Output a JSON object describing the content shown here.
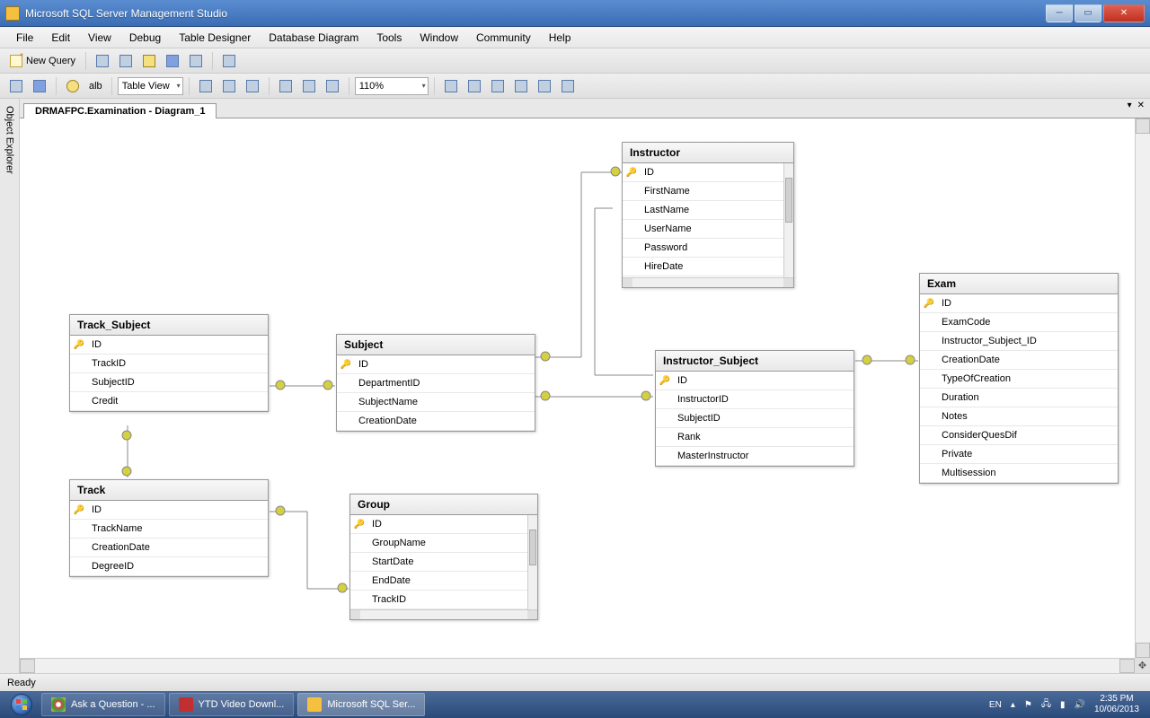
{
  "window": {
    "title": "Microsoft SQL Server Management Studio"
  },
  "menu": [
    "File",
    "Edit",
    "View",
    "Debug",
    "Table Designer",
    "Database Diagram",
    "Tools",
    "Window",
    "Community",
    "Help"
  ],
  "toolbar1": {
    "new_query": "New Query",
    "table_view": "Table View",
    "alb_label": "alb",
    "zoom": "110%"
  },
  "sidebar": {
    "object_explorer": "Object Explorer"
  },
  "tab": {
    "label": "DRMAFPC.Examination - Diagram_1"
  },
  "tables": {
    "track_subject": {
      "title": "Track_Subject",
      "cols": [
        "ID",
        "TrackID",
        "SubjectID",
        "Credit"
      ]
    },
    "subject": {
      "title": "Subject",
      "cols": [
        "ID",
        "DepartmentID",
        "SubjectName",
        "CreationDate"
      ]
    },
    "track": {
      "title": "Track",
      "cols": [
        "ID",
        "TrackName",
        "CreationDate",
        "DegreeID"
      ]
    },
    "group": {
      "title": "Group",
      "cols": [
        "ID",
        "GroupName",
        "StartDate",
        "EndDate",
        "TrackID"
      ]
    },
    "instructor": {
      "title": "Instructor",
      "cols": [
        "ID",
        "FirstName",
        "LastName",
        "UserName",
        "Password",
        "HireDate"
      ]
    },
    "instructor_subject": {
      "title": "Instructor_Subject",
      "cols": [
        "ID",
        "InstructorID",
        "SubjectID",
        "Rank",
        "MasterInstructor"
      ]
    },
    "exam": {
      "title": "Exam",
      "cols": [
        "ID",
        "ExamCode",
        "Instructor_Subject_ID",
        "CreationDate",
        "TypeOfCreation",
        "Duration",
        "Notes",
        "ConsiderQuesDif",
        "Private",
        "Multisession"
      ]
    }
  },
  "status": {
    "ready": "Ready"
  },
  "taskbar": {
    "items": [
      {
        "label": "Ask a Question - ..."
      },
      {
        "label": "YTD Video Downl..."
      },
      {
        "label": "Microsoft SQL Ser..."
      }
    ],
    "lang": "EN",
    "time": "2:35 PM",
    "date": "10/06/2013"
  }
}
